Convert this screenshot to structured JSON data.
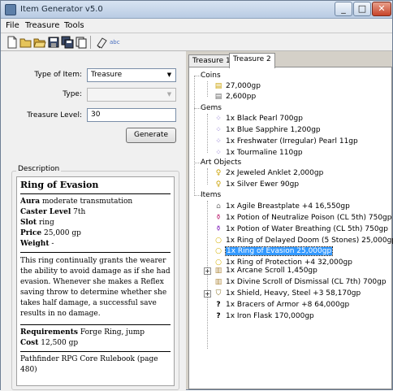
{
  "window": {
    "title": "Item Generator v5.0",
    "min": "_",
    "max": "□",
    "close": "✕"
  },
  "menu": [
    "File",
    "Treasure",
    "Tools"
  ],
  "toolbar": [
    "new-icon",
    "open-icon",
    "open-folder-icon",
    "save-icon",
    "save-all-icon",
    "copy-icon",
    "eraser-icon",
    "abc-icon"
  ],
  "toolbar_abc": "abc",
  "form": {
    "type_of_item_label": "Type of Item:",
    "type_of_item_value": "Treasure",
    "type_label": "Type:",
    "type_value": "",
    "treasure_level_label": "Treasure Level:",
    "treasure_level_value": "30",
    "generate_label": "Generate"
  },
  "description": {
    "label": "Description",
    "title": "Ring of Evasion",
    "aura_label": "Aura",
    "aura": "moderate transmutation",
    "caster_label": "Caster Level",
    "caster": "7th",
    "slot_label": "Slot",
    "slot": "ring",
    "price_label": "Price",
    "price": "25,000 gp",
    "weight_label": "Weight",
    "weight": "-",
    "body": "This ring continually grants the wearer the ability to avoid damage as if she had evasion. Whenever she makes a Reflex saving throw to determine whether she takes half damage, a successful save results in no damage.",
    "req_label": "Requirements",
    "req": "Forge Ring, jump",
    "cost_label": "Cost",
    "cost": "12,500 gp",
    "source": "Pathfinder RPG Core Rulebook (page 480)"
  },
  "tabs": [
    "Treasure 1",
    "Treasure 2"
  ],
  "active_tab": 1,
  "tree": {
    "coins_label": "Coins",
    "coins": [
      "27,000gp",
      "2,600pp"
    ],
    "gems_label": "Gems",
    "gems": [
      "1x  Black Pearl  700gp",
      "1x  Blue Sapphire  1,200gp",
      "1x  Freshwater (Irregular) Pearl  11gp",
      "1x  Tourmaline  110gp"
    ],
    "art_label": "Art Objects",
    "art": [
      "2x  Jeweled Anklet  2,000gp",
      "1x  Silver Ewer  90gp"
    ],
    "items_label": "Items",
    "items": [
      "1x  Agile Breastplate +4  16,550gp",
      "1x  Potion of Neutralize Poison (CL 5th)  750gp",
      "1x  Potion of Water Breathing (CL 5th)  750gp",
      "1x  Ring of Delayed Doom (5 Stones)  25,000gp",
      "1x  Ring of Evasion  25,000gp",
      "1x  Ring of Protection +4  32,000gp",
      "1x  Arcane Scroll  1,450gp",
      "1x  Divine Scroll of Dismissal (CL 7th)  700gp",
      "1x  Shield, Heavy, Steel +3  58,170gp",
      "1x  Bracers of Armor +8  64,000gp",
      "1x  Iron Flask  170,000gp"
    ],
    "selected_item": 4
  }
}
